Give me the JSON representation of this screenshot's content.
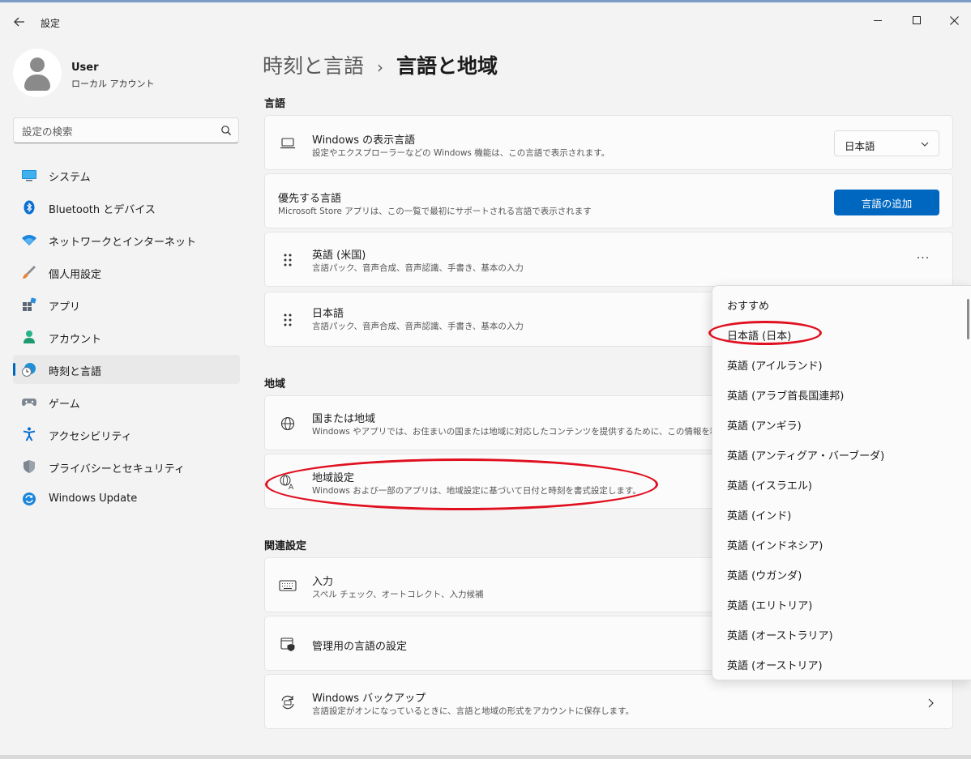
{
  "window": {
    "title": "設定"
  },
  "profile": {
    "name": "User",
    "account_type": "ローカル アカウント"
  },
  "search": {
    "placeholder": "設定の検索"
  },
  "sidebar": {
    "items": [
      {
        "label": "システム",
        "icon": "system-icon"
      },
      {
        "label": "Bluetooth とデバイス",
        "icon": "bluetooth-icon"
      },
      {
        "label": "ネットワークとインターネット",
        "icon": "wifi-icon"
      },
      {
        "label": "個人用設定",
        "icon": "brush-icon"
      },
      {
        "label": "アプリ",
        "icon": "apps-icon"
      },
      {
        "label": "アカウント",
        "icon": "account-icon"
      },
      {
        "label": "時刻と言語",
        "icon": "time-language-icon"
      },
      {
        "label": "ゲーム",
        "icon": "gamepad-icon"
      },
      {
        "label": "アクセシビリティ",
        "icon": "accessibility-icon"
      },
      {
        "label": "プライバシーとセキュリティ",
        "icon": "shield-icon"
      },
      {
        "label": "Windows Update",
        "icon": "update-icon"
      }
    ],
    "active_index": 6
  },
  "breadcrumb": {
    "parent": "時刻と言語",
    "separator": "›",
    "current": "言語と地域"
  },
  "sections": {
    "language": "言語",
    "region": "地域",
    "related": "関連設定"
  },
  "display_language": {
    "title": "Windows の表示言語",
    "subtitle": "設定やエクスプローラーなどの Windows 機能は、この言語で表示されます。",
    "selected": "日本語"
  },
  "preferred_languages": {
    "title": "優先する言語",
    "subtitle": "Microsoft Store アプリは、この一覧で最初にサポートされる言語で表示されます",
    "add_button": "言語の追加"
  },
  "languages": [
    {
      "title": "英語 (米国)",
      "subtitle": "言語パック、音声合成、音声認識、手書き、基本の入力",
      "more": "···"
    },
    {
      "title": "日本語",
      "subtitle": "言語パック、音声合成、音声認識、手書き、基本の入力"
    }
  ],
  "region": {
    "country": {
      "title": "国または地域",
      "subtitle": "Windows やアプリでは、お住まいの国または地域に対応したコンテンツを提供するために、この情報を利用す"
    },
    "format": {
      "title": "地域設定",
      "subtitle": "Windows および一部のアプリは、地域設定に基づいて日付と時刻を書式設定します。"
    }
  },
  "related": {
    "typing": {
      "title": "入力",
      "subtitle": "スペル チェック、オートコレクト、入力候補"
    },
    "admin": {
      "title": "管理用の言語の設定"
    },
    "backup": {
      "title": "Windows バックアップ",
      "subtitle": "言語設定がオンになっているときに、言語と地域の形式をアカウントに保存します。"
    }
  },
  "flyout": {
    "items": [
      "おすすめ",
      "日本語 (日本)",
      "英語 (アイルランド)",
      "英語 (アラブ首長国連邦)",
      "英語 (アンギラ)",
      "英語 (アンティグア・バーブーダ)",
      "英語 (イスラエル)",
      "英語 (インド)",
      "英語 (インドネシア)",
      "英語 (ウガンダ)",
      "英語 (エリトリア)",
      "英語 (オーストラリア)",
      "英語 (オーストリア)"
    ]
  },
  "colors": {
    "accent": "#0067c0",
    "annotation": "#e01020",
    "background": "#f3f3f3",
    "card": "#fbfbfb"
  }
}
